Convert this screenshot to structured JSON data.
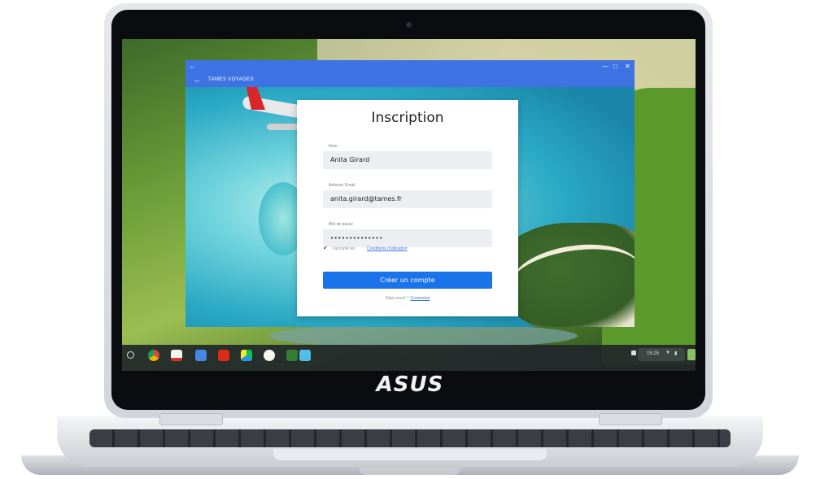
{
  "device": {
    "brand": "ASUS"
  },
  "app": {
    "title": "TAMES VOYAGES"
  },
  "form": {
    "title": "Inscription",
    "name_label": "Nom",
    "name_value": "Anita Girard",
    "email_label": "Adresse Email",
    "email_value": "anita.girard@tames.fr",
    "password_label": "Mot de passe",
    "password_value": "••••••••••••••",
    "terms_text": "J'accepte les",
    "terms_link": "Conditions d'utilisation",
    "terms_checked": true,
    "submit_label": "Créer un compte",
    "signin_text": "Déjà inscrit ?",
    "signin_link": "Connexion"
  },
  "shelf": {
    "time": "15:25",
    "apps": [
      "chrome",
      "gmail",
      "docs",
      "youtube",
      "play-store",
      "files",
      "tames-app",
      "calendar"
    ]
  },
  "colors": {
    "titlebar": "#3f73e4",
    "button": "#1a73e8"
  }
}
